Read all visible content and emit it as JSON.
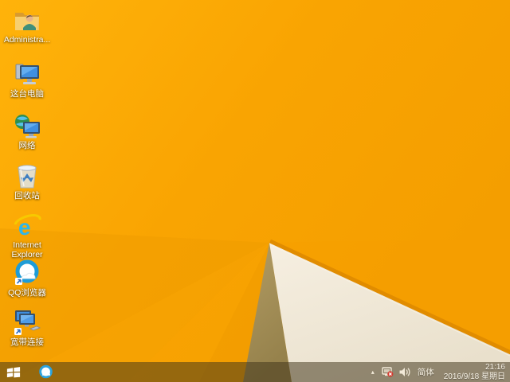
{
  "desktop": {
    "icons": [
      {
        "name": "administrator-folder",
        "label": "Administra..."
      },
      {
        "name": "this-pc",
        "label": "这台电脑"
      },
      {
        "name": "network",
        "label": "网络"
      },
      {
        "name": "recycle-bin",
        "label": "回收站"
      },
      {
        "name": "internet-explorer",
        "label": "Internet Explorer"
      },
      {
        "name": "qq-browser",
        "label": "QQ浏览器"
      },
      {
        "name": "broadband-connection",
        "label": "宽带连接"
      }
    ]
  },
  "taskbar": {
    "pinned_apps": [
      {
        "name": "qq-browser"
      }
    ],
    "tray": {
      "hidden_icons_glyph": "▴",
      "input_method_label": "简体",
      "time": "21:16",
      "date": "2016/9/18 星期日"
    }
  },
  "colors": {
    "wallpaper_orange_light": "#ffb108",
    "wallpaper_orange_base": "#f9a402",
    "wallpaper_orange_deep": "#f49e00",
    "fold_ridge": "#e18c00",
    "fold_olive": "#a8915a",
    "fold_cream": "#f3ecdd",
    "taskbar_overlay": "rgba(64,52,26,0.53)",
    "icon_label_text": "#ffffff",
    "tray_text": "#fbf6ea",
    "ie_blue": "#2fb6ea",
    "qq_blue": "#1e9cd7",
    "network_error_red": "#d23b2f"
  }
}
